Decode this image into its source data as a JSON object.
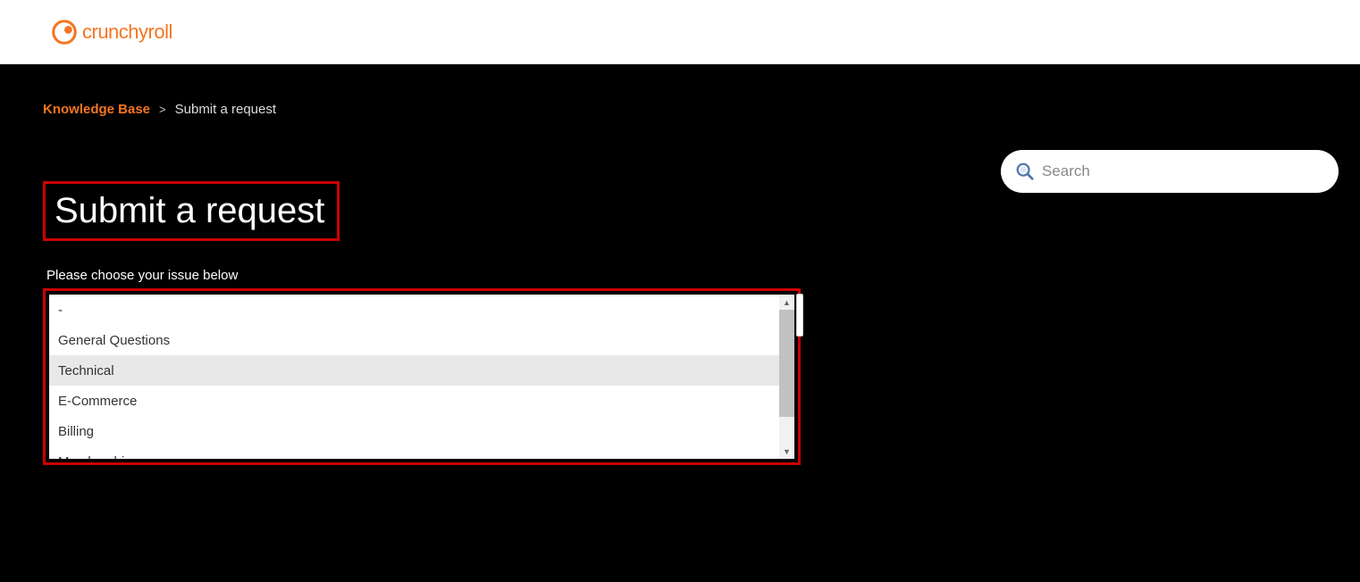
{
  "brand": {
    "name": "crunchyroll"
  },
  "breadcrumb": {
    "link": "Knowledge Base",
    "separator": ">",
    "current": "Submit a request"
  },
  "search": {
    "placeholder": "Search"
  },
  "page": {
    "title": "Submit a request"
  },
  "form": {
    "label": "Please choose your issue below",
    "options": [
      "-",
      "General Questions",
      "Technical",
      "E-Commerce",
      "Billing",
      "Membership"
    ],
    "highlighted_index": 2
  }
}
